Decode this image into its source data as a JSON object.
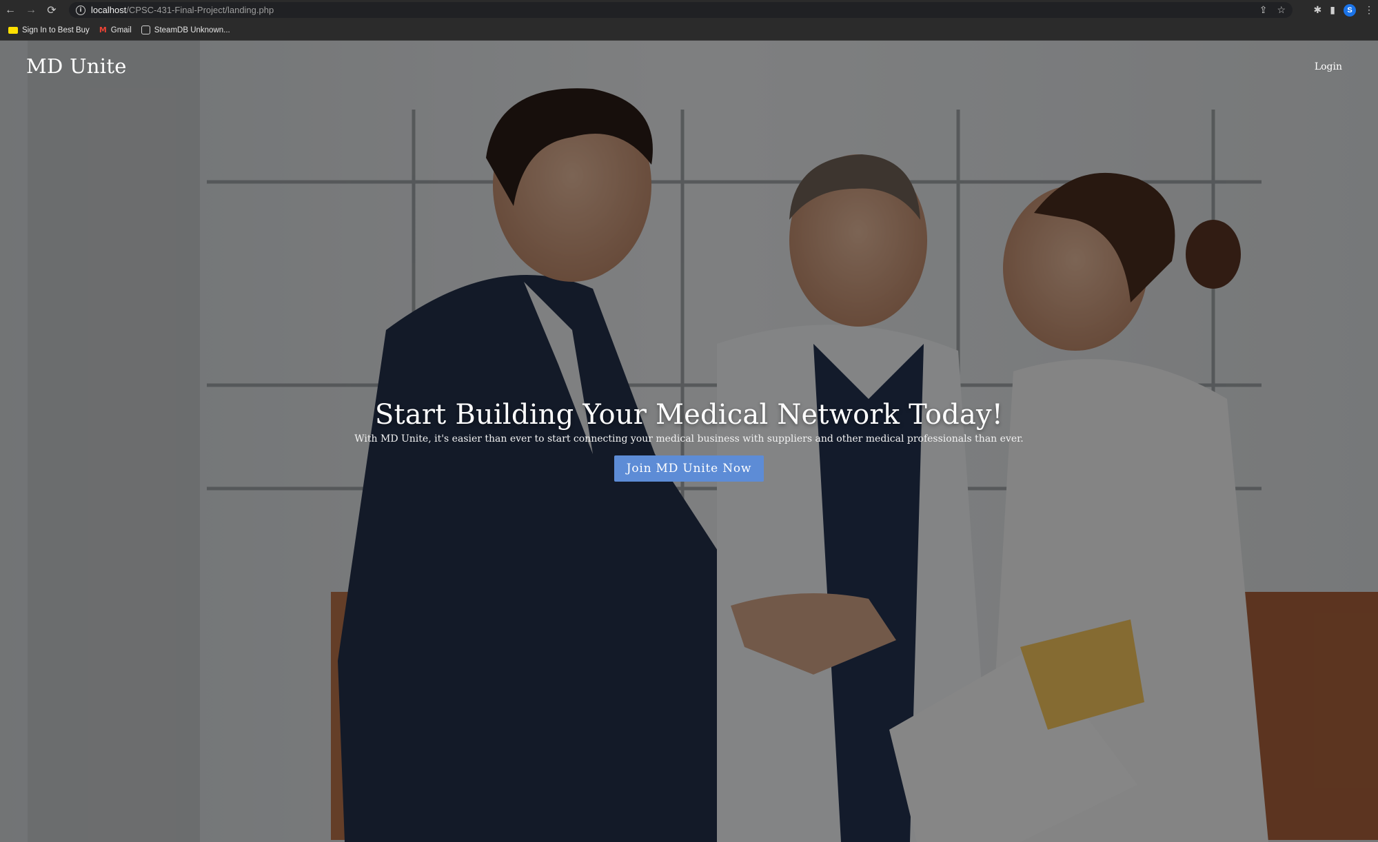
{
  "browser": {
    "url_host": "localhost",
    "url_path": "/CPSC-431-Final-Project/landing.php",
    "profile_initial": "S",
    "bookmarks": [
      {
        "label": "Sign In to Best Buy",
        "icon": "bestbuy-icon"
      },
      {
        "label": "Gmail",
        "icon": "gmail-icon"
      },
      {
        "label": "SteamDB Unknown...",
        "icon": "steamdb-icon"
      }
    ],
    "icons": {
      "back": "←",
      "forward": "→",
      "reload": "⟳",
      "info": "i",
      "share": "⇪",
      "star": "☆",
      "extensions": "✱",
      "sidepanel": "▮",
      "menu": "⋮",
      "gmail": "M"
    }
  },
  "header": {
    "brand": "MD Unite",
    "login_label": "Login"
  },
  "hero": {
    "title": "Start Building Your Medical Network Today!",
    "subtitle": "With MD Unite, it's easier than ever to start connecting your medical business with suppliers and other medical professionals than ever.",
    "cta_label": "Join MD Unite Now"
  },
  "colors": {
    "cta": "#5d8cd6",
    "chrome": "#2b2b2b",
    "omnibox": "#202124"
  }
}
